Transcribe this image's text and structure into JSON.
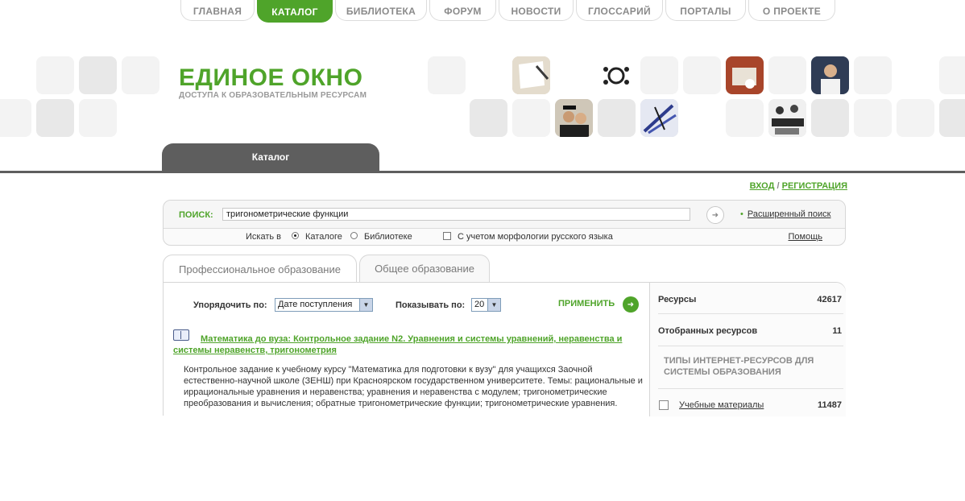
{
  "nav": {
    "items": [
      {
        "label": "ГЛАВНАЯ"
      },
      {
        "label": "КАТАЛОГ"
      },
      {
        "label": "БИБЛИОТЕКА"
      },
      {
        "label": "ФОРУМ"
      },
      {
        "label": "НОВОСТИ"
      },
      {
        "label": "ГЛОССАРИЙ"
      },
      {
        "label": "ПОРТАЛЫ"
      },
      {
        "label": "О ПРОЕКТЕ"
      }
    ],
    "active": "КАТАЛОГ"
  },
  "header": {
    "logo_title": "ЕДИНОЕ ОКНО",
    "logo_subtitle": "ДОСТУПА К ОБРАЗОВАТЕЛЬНЫМ РЕСУРСАМ"
  },
  "section_tab": "Каталог",
  "auth": {
    "login": "ВХОД",
    "separator": "/",
    "register": "РЕГИСТРАЦИЯ"
  },
  "search": {
    "label": "ПОИСК:",
    "value": "тригонометрические функции",
    "advanced_label": "Расширенный поиск",
    "search_in_label": "Искать в",
    "option_catalog": "Каталоге",
    "option_library": "Библиотеке",
    "selected_option": "Каталоге",
    "morphology_label": "С учетом морфологии русского языка",
    "morphology_checked": false,
    "help_label": "Помощь"
  },
  "tabs": [
    {
      "label": "Профессиональное образование",
      "active": true
    },
    {
      "label": "Общее образование",
      "active": false
    }
  ],
  "controls": {
    "sort_label": "Упорядочить по:",
    "sort_value": "Дате поступления",
    "show_label": "Показывать по:",
    "show_value": "20",
    "apply_label": "ПРИМЕНИТЬ"
  },
  "results": [
    {
      "title": "Математика до вуза: Контрольное задание N2. Уравнения и системы уравнений, неравенства и системы неравенств, тригонометрия",
      "description": "Контрольное задание к учебному курсу \"Математика для подготовки к вузу\" для учащихся Заочной естественно-научной школе (ЗЕНШ) при Красноярском государственном университете. Темы: рациональные и иррациональные уравнения и неравенства; уравнения и неравенства с модулем; тригонометрические преобразования и вычисления; обратные тригонометрические функции; тригонометрические уравнения."
    }
  ],
  "sidebar": {
    "resources_label": "Ресурсы",
    "resources_count": "42617",
    "selected_label": "Отобранных ресурсов",
    "selected_count": "11",
    "types_heading": "ТИПЫ ИНТЕРНЕТ-РЕСУРСОВ ДЛЯ СИСТЕМЫ ОБРАЗОВАНИЯ",
    "types": [
      {
        "label": "Учебные материалы",
        "count": "11487",
        "checked": false
      }
    ]
  },
  "colors": {
    "accent": "#4fa42a",
    "dark_tab": "#5e5e5e"
  }
}
